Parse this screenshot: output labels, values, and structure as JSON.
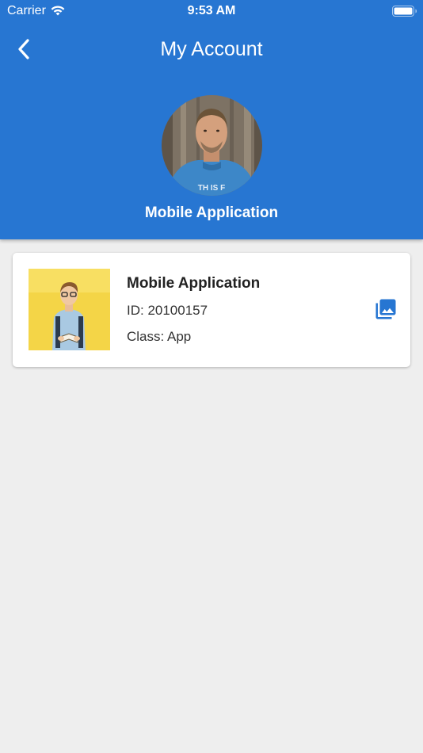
{
  "status_bar": {
    "carrier": "Carrier",
    "time": "9:53 AM"
  },
  "header": {
    "title": "My Account",
    "profile_name": "Mobile Application"
  },
  "card": {
    "name": "Mobile Application",
    "id_text": "ID: 20100157",
    "class_text": "Class: App"
  },
  "colors": {
    "primary": "#2776d2",
    "background": "#eeeeee"
  },
  "icons": [
    "wifi-icon",
    "battery-icon",
    "back-chevron-icon",
    "photo-library-icon"
  ]
}
